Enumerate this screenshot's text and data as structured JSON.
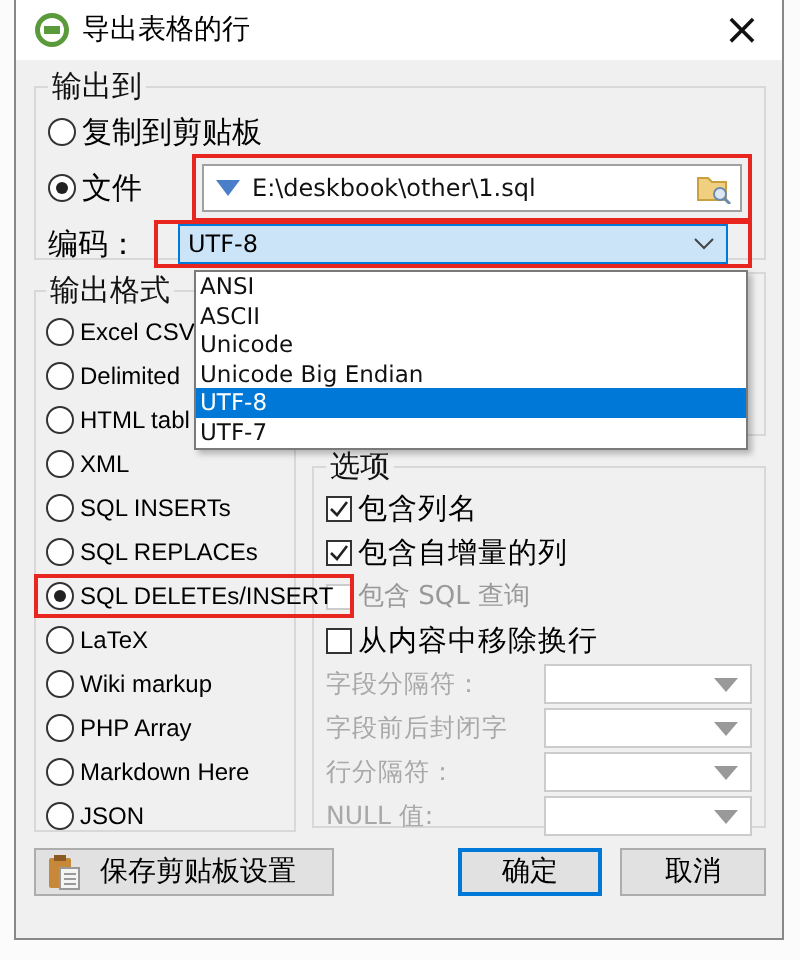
{
  "window": {
    "title": "导出表格的行",
    "close": "×"
  },
  "output_to": {
    "title": "输出到",
    "options": [
      {
        "label": "复制到剪贴板",
        "selected": false
      },
      {
        "label": "文件",
        "selected": true
      }
    ],
    "file": {
      "value": "E:\\deskbook\\other\\1.sql",
      "highlighted": true
    },
    "encoding": {
      "label": "编码：",
      "value": "UTF-8",
      "highlighted": true,
      "expanded": true,
      "options": [
        {
          "label": "ANSI",
          "selected": false
        },
        {
          "label": "ASCII",
          "selected": false
        },
        {
          "label": "Unicode",
          "selected": false
        },
        {
          "label": "Unicode Big Endian",
          "selected": false
        },
        {
          "label": "UTF-8",
          "selected": true
        },
        {
          "label": "UTF-7",
          "selected": false
        }
      ]
    }
  },
  "format": {
    "title": "输出格式",
    "options": [
      {
        "label": "Excel CSV",
        "selected": false,
        "highlighted": false
      },
      {
        "label": "Delimited",
        "selected": false,
        "highlighted": false
      },
      {
        "label": "HTML tabl",
        "selected": false,
        "highlighted": false
      },
      {
        "label": "XML",
        "selected": false,
        "highlighted": false
      },
      {
        "label": "SQL INSERTs",
        "selected": false,
        "highlighted": false
      },
      {
        "label": "SQL REPLACEs",
        "selected": false,
        "highlighted": false
      },
      {
        "label": "SQL DELETEs/INSERT",
        "selected": true,
        "highlighted": true
      },
      {
        "label": "LaTeX",
        "selected": false,
        "highlighted": false
      },
      {
        "label": "Wiki markup",
        "selected": false,
        "highlighted": false
      },
      {
        "label": "PHP Array",
        "selected": false,
        "highlighted": false
      },
      {
        "label": "Markdown Here",
        "selected": false,
        "highlighted": false
      },
      {
        "label": "JSON",
        "selected": false,
        "highlighted": false
      }
    ]
  },
  "options": {
    "title": "选项",
    "checkboxes": [
      {
        "label": "包含列名",
        "checked": true,
        "disabled": false
      },
      {
        "label": "包含自增量的列",
        "checked": true,
        "disabled": false
      },
      {
        "label": "包含 SQL 查询",
        "checked": false,
        "disabled": true
      },
      {
        "label": "从内容中移除换行",
        "checked": false,
        "disabled": false
      }
    ],
    "fields": [
      {
        "label": "字段分隔符：",
        "disabled": true
      },
      {
        "label": "字段前后封闭字",
        "disabled": true
      },
      {
        "label": "行分隔符：",
        "disabled": true
      },
      {
        "label": "NULL 值:",
        "disabled": true
      }
    ]
  },
  "buttons": [
    {
      "label": "保存剪贴板设置",
      "kind": "icon",
      "default": false
    },
    {
      "label": "确定",
      "kind": "plain",
      "default": true
    },
    {
      "label": "取消",
      "kind": "plain",
      "default": false
    }
  ]
}
